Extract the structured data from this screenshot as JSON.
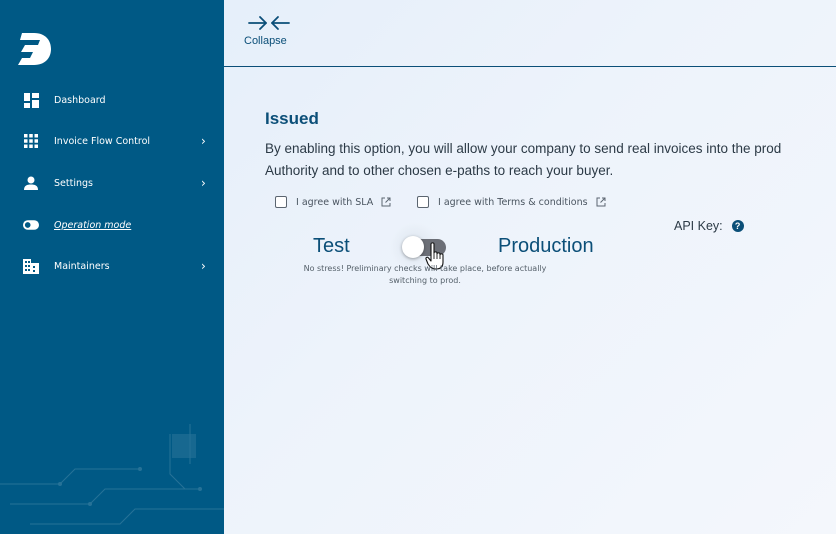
{
  "sidebar": {
    "logo": "logo-icon",
    "items": [
      {
        "label": "Dashboard",
        "icon": "dashboard-icon",
        "chevron": false
      },
      {
        "label": "Invoice Flow Control",
        "icon": "grid-icon",
        "chevron": true
      },
      {
        "label": "Settings",
        "icon": "user-icon",
        "chevron": true
      },
      {
        "label": "Operation mode",
        "icon": "toggle-icon",
        "chevron": false,
        "active": true
      },
      {
        "label": "Maintainers",
        "icon": "building-icon",
        "chevron": true
      }
    ],
    "chevron_glyph": "›"
  },
  "topbar": {
    "collapse_label": "Collapse",
    "collapse_icon": "collapse-arrows-icon"
  },
  "main": {
    "title": "Issued",
    "description_line1": "By enabling this option, you will allow your company to send real invoices into the prod",
    "description_line2": "Authority and to other chosen e-paths to reach your buyer.",
    "checks": [
      {
        "label": "I agree with SLA",
        "checked": false
      },
      {
        "label": "I agree with Terms & conditions",
        "checked": false
      }
    ],
    "api_key_label": "API Key:",
    "help_glyph": "?",
    "mode_test": "Test",
    "mode_prod": "Production",
    "toggle_on": false,
    "hint_line1": "No stress! Preliminary checks will take place, before actually",
    "hint_line2": "switching to prod."
  },
  "colors": {
    "sidebar_bg": "#005985",
    "accent": "#0b4f78",
    "toggle_track": "#6c6f77"
  }
}
